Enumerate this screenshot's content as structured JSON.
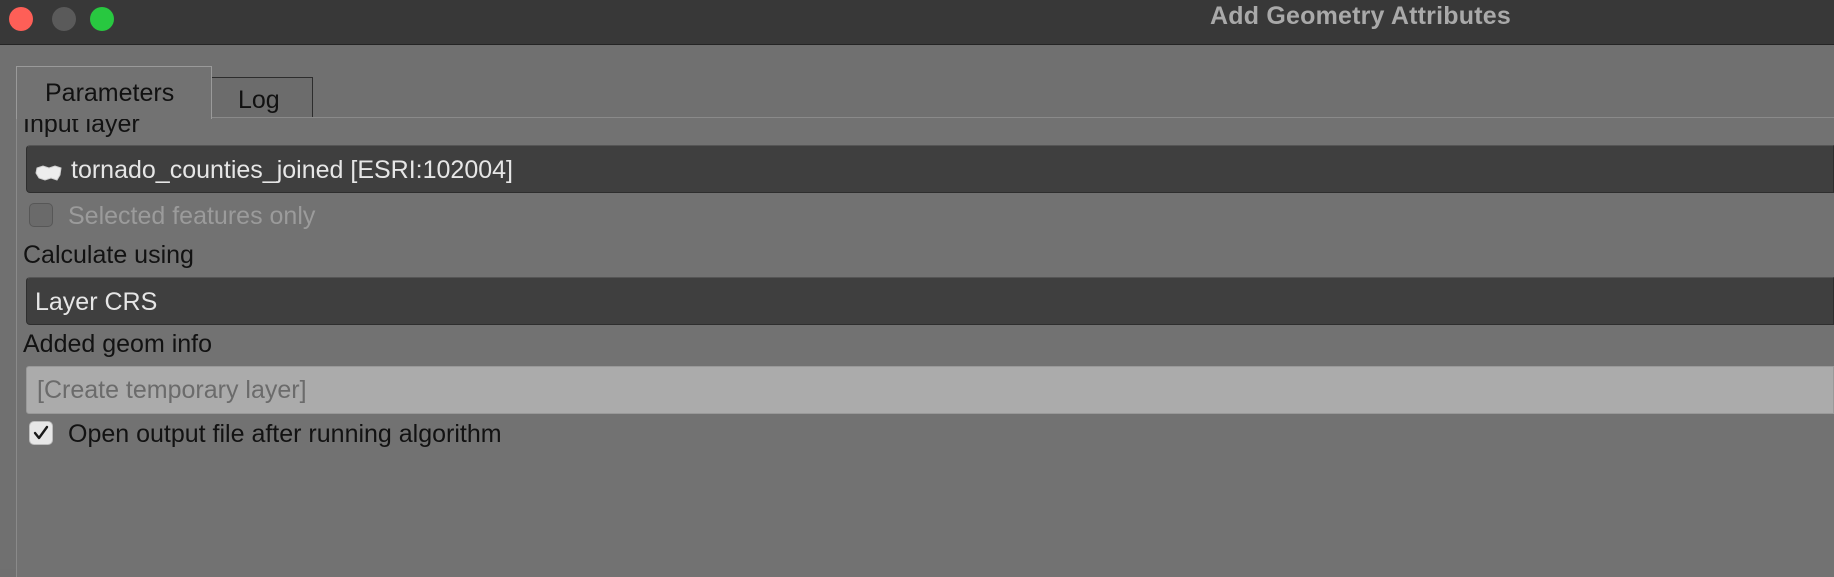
{
  "window": {
    "title": "Add Geometry Attributes"
  },
  "tabs": [
    {
      "label": "Parameters",
      "active": true
    },
    {
      "label": "Log",
      "active": false
    }
  ],
  "input_layer": {
    "label": "Input layer",
    "value": "tornado_counties_joined [ESRI:102004]",
    "icon": "polygon-layer-icon"
  },
  "selected_features": {
    "label": "Selected features only",
    "checked": false,
    "enabled": false
  },
  "calculate_using": {
    "label": "Calculate using",
    "value": "Layer CRS"
  },
  "added_geom_info": {
    "label": "Added geom info",
    "placeholder": "[Create temporary layer]"
  },
  "open_output": {
    "label": "Open output file after running algorithm",
    "checked": true
  },
  "colors": {
    "close": "#fe5f57",
    "minimize": "#5a5a5a",
    "maximize": "#28c840",
    "background": "#707070",
    "combo": "#3f3f3f",
    "output_field": "#ababab"
  }
}
